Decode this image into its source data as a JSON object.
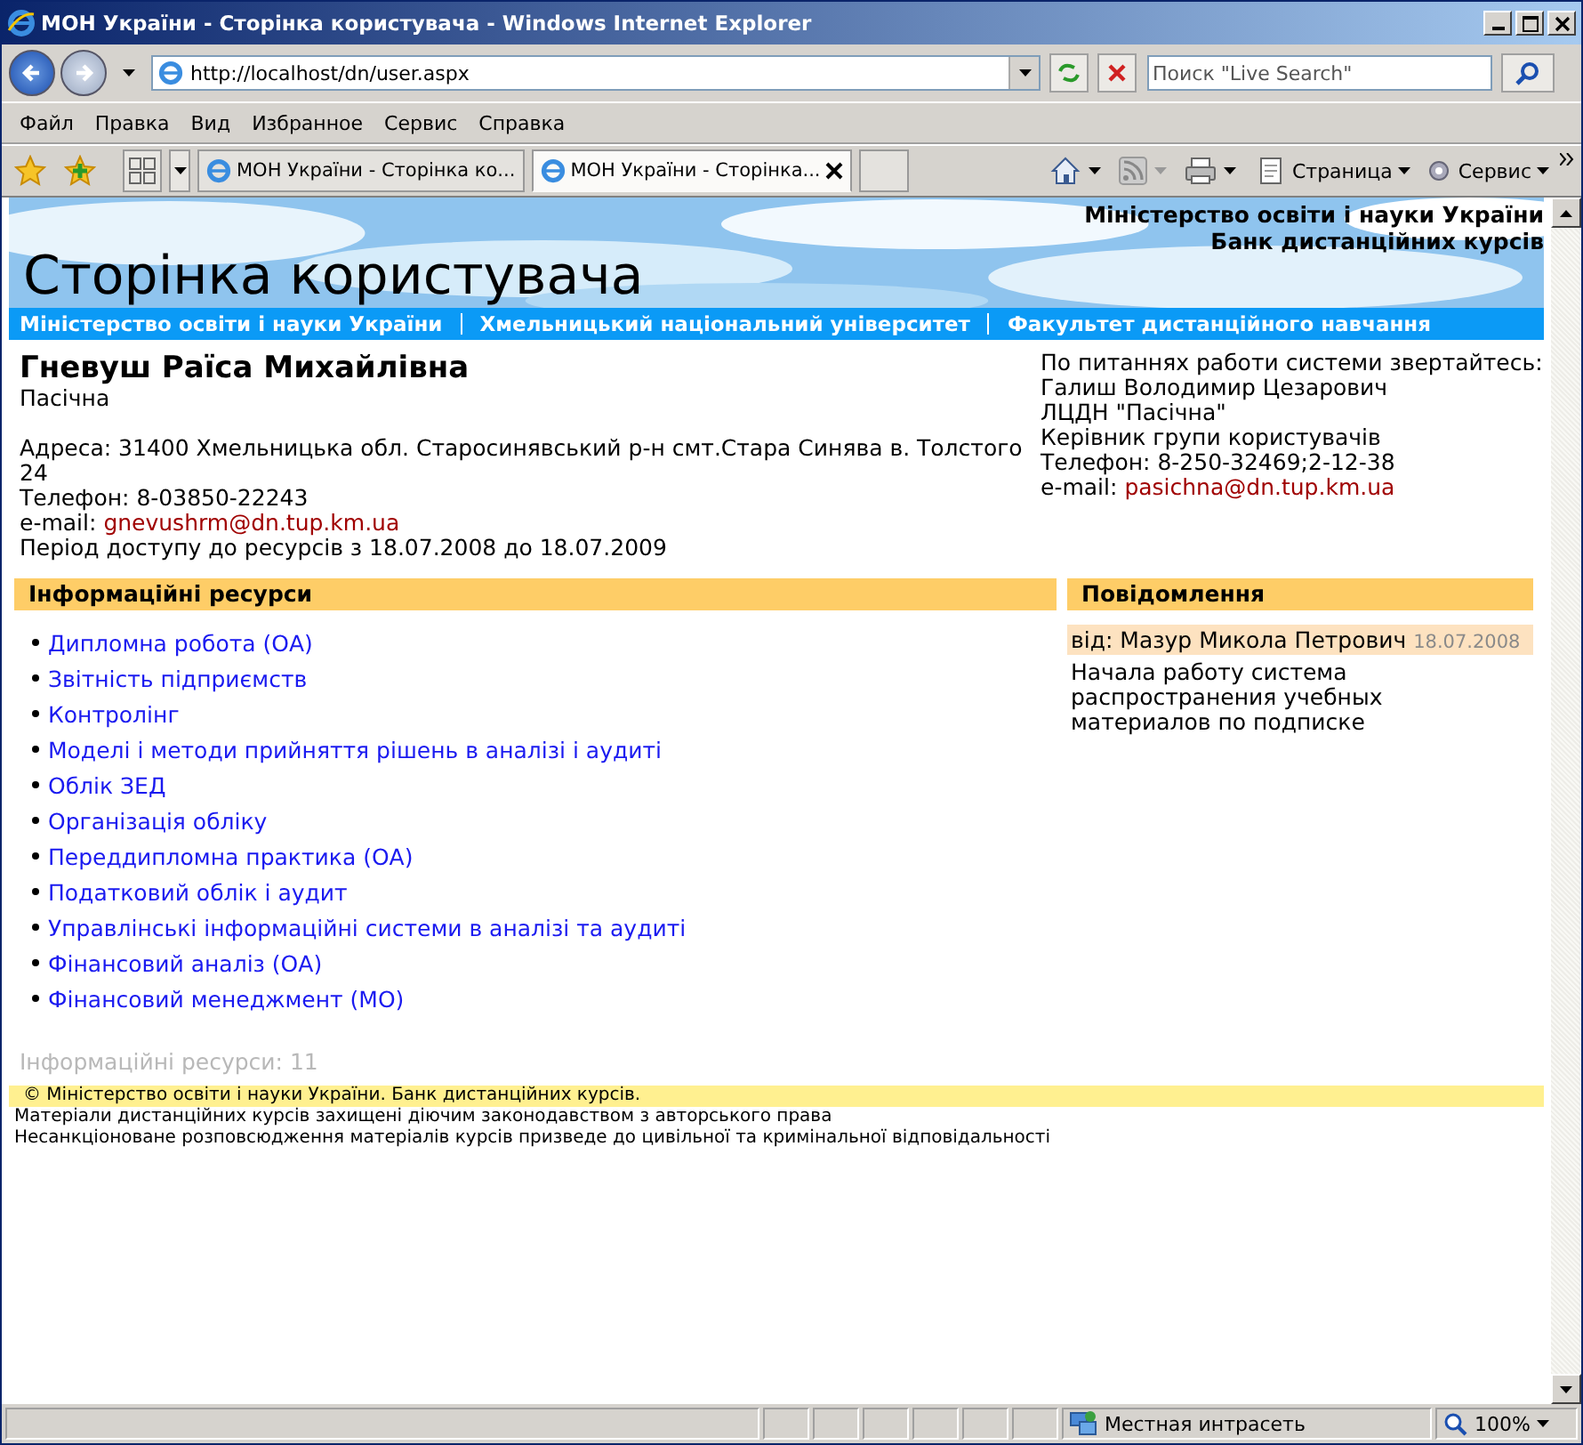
{
  "window": {
    "title": "МОН України - Сторінка користувача - Windows Internet Explorer"
  },
  "address": {
    "url": "http://localhost/dn/user.aspx"
  },
  "search": {
    "placeholder": "Поиск \"Live Search\""
  },
  "menu": [
    "Файл",
    "Правка",
    "Вид",
    "Избранное",
    "Сервис",
    "Справка"
  ],
  "tabs": [
    {
      "label": "МОН України - Сторінка ко...",
      "selected": false
    },
    {
      "label": "МОН України - Сторінка...",
      "selected": true
    }
  ],
  "toolbar": [
    "Страница",
    "Сервис"
  ],
  "page": {
    "header": {
      "org": "Міністерство освіти і науки України",
      "bank": "Банк дистанційних курсів",
      "title": "Сторінка користувача"
    },
    "nav": [
      "Міністерство освіти і науки України",
      "Хмельницький національний університет",
      "Факультет дистанційного навчання"
    ],
    "user": {
      "name": "Гневуш Раїса Михайлівна",
      "org": "Пасічна",
      "address": "Адреса: 31400 Хмельницька обл. Старосинявський р-н смт.Стара Синява в. Толстого 24",
      "phone": "Телефон: 8-03850-22243",
      "email_label": "e-mail:",
      "email": "gnevushrm@dn.tup.km.ua",
      "period": "Період доступу до ресурсів з 18.07.2008 до 18.07.2009"
    },
    "contact": {
      "lines": [
        "По питаннях работи системи звертайтесь:",
        "Галиш Володимир Цезарович",
        "ЛЦДН \"Пасічна\"",
        "Керівник групи користувачів",
        "Телефон: 8-250-32469;2-12-38"
      ],
      "email_label": "e-mail:",
      "email": "pasichna@dn.tup.km.ua"
    },
    "resources": {
      "heading": "Інформаційні ресурси",
      "items": [
        "Дипломна робота (ОА)",
        "Звітність підприємств",
        "Контролінг",
        "Моделі і методи прийняття рішень в аналізі і аудиті",
        "Облік ЗЕД",
        "Організація обліку",
        "Переддипломна практика (ОА)",
        "Податковий облік і аудит",
        "Управлінські інформаційні системи в аналізі та аудиті",
        "Фінансовий аналіз (ОА)",
        "Фінансовий менеджмент (МО)"
      ],
      "count": "Інформаційні ресурси: 11"
    },
    "messages": {
      "heading": "Повідомлення",
      "items": [
        {
          "from": "від: Мазур Микола Петрович",
          "date": "18.07.2008",
          "text": "Начала работу система распространения учебных материалов по подписке"
        }
      ]
    },
    "footer": {
      "copyright": "© Міністерство освіти і науки України. Банк дистанційних курсів.",
      "lines": [
        "Матеріали дистанційних курсів захищені діючим законодавством з авторського права",
        "Несанкціоноване розповсюдження матеріалів курсів призведе до цивільної та кримінальної відповідальності"
      ]
    }
  },
  "status": {
    "zone": "Местная интрасеть",
    "zoom": "100%"
  }
}
